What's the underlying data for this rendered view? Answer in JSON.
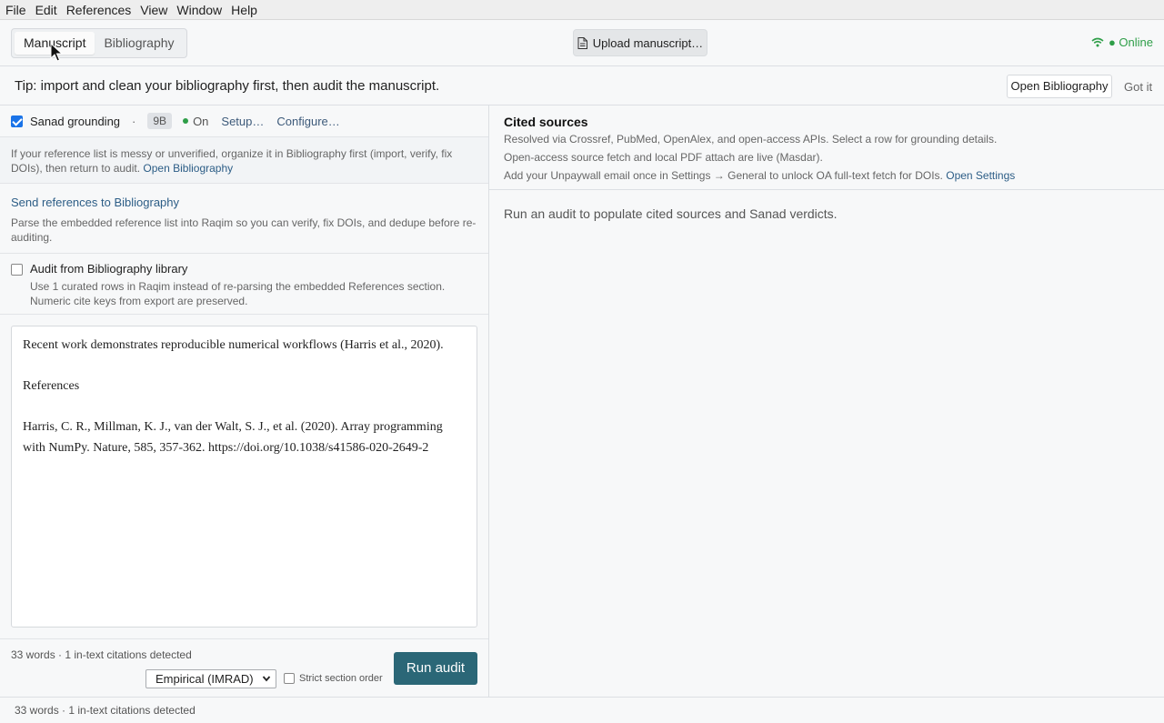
{
  "menu": [
    "File",
    "Edit",
    "References",
    "View",
    "Window",
    "Help"
  ],
  "tabs": [
    {
      "label": "Manuscript",
      "active": true
    },
    {
      "label": "Bibliography",
      "active": false
    }
  ],
  "upload": {
    "label": "Upload manuscript…"
  },
  "connection": {
    "label": "● Online",
    "color": "#2e9e48"
  },
  "tip": {
    "text": "Tip: import and clean your bibliography first, then audit the manuscript.",
    "open_label": "Open Bibliography",
    "dismiss_label": "Got it"
  },
  "sanad": {
    "checked": true,
    "label": "Sanad grounding",
    "separator": "·",
    "badge": "9B",
    "status": "On",
    "setup_label": "Setup…",
    "configure_label": "Configure…"
  },
  "info": {
    "text": "If your reference list is messy or unverified, organize it in Bibliography first (import, verify, fix DOIs), then return to audit.",
    "link": "Open Bibliography"
  },
  "send": {
    "title": "Send references to Bibliography",
    "desc": "Parse the embedded reference list into Raqim so you can verify, fix DOIs, and dedupe before re-auditing."
  },
  "audit_library": {
    "checked": false,
    "title": "Audit from Bibliography library",
    "desc": "Use 1 curated rows in Raqim instead of re-parsing the embedded References section. Numeric cite keys from export are preserved."
  },
  "manuscript": {
    "paragraphs": [
      "Recent work demonstrates reproducible numerical workflows (Harris et al., 2020).",
      "References",
      "Harris, C. R., Millman, K. J., van der Walt, S. J., et al. (2020). Array programming with NumPy. Nature, 585, 357-362. https://doi.org/10.1038/s41586-020-2649-2"
    ]
  },
  "footer": {
    "word_count": "33 words · 1 in-text citations detected",
    "template": "Empirical (IMRAD)",
    "strict_label": "Strict section order",
    "strict_checked": false,
    "run_label": "Run audit"
  },
  "cited": {
    "title": "Cited sources",
    "line1": "Resolved via Crossref, PubMed, OpenAlex, and open-access APIs. Select a row for grounding details.",
    "line2": "Open-access source fetch and local PDF attach are live (Masdar).",
    "line3": "Add your Unpaywall email once in Settings → General to unlock OA full-text fetch for DOIs.",
    "line3_link": "Open Settings",
    "empty": "Run an audit to populate cited sources and Sanad verdicts."
  },
  "statusbar": {
    "text": "33 words · 1 in-text citations detected"
  },
  "colors": {
    "accent": "#2b6777",
    "link": "#2c5d86",
    "online": "#2e9e48",
    "checkbox": "#1a73e8"
  }
}
